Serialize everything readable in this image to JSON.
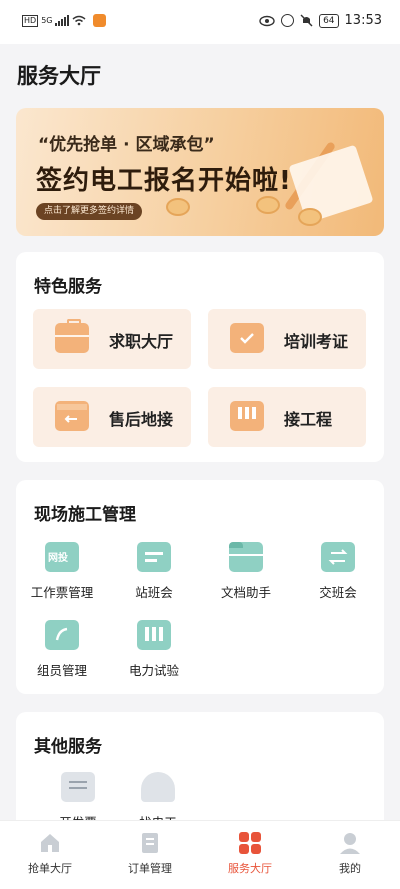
{
  "status_bar": {
    "left_badges": [
      "HD",
      "5G"
    ],
    "battery": "64",
    "time": "13:53",
    "icons": [
      "signal-icon",
      "wifi-icon",
      "app-notification-icon",
      "eye-icon",
      "alarm-icon",
      "mute-icon",
      "battery-icon"
    ]
  },
  "page": {
    "title": "服务大厅"
  },
  "banner": {
    "subtitle": "“优先抢单 · 区域承包”",
    "headline": "签约电工报名开始啦!",
    "pill": "点击了解更多签约详情"
  },
  "featured": {
    "title": "特色服务",
    "items": [
      {
        "label": "求职大厅",
        "icon": "briefcase-icon"
      },
      {
        "label": "培训考证",
        "icon": "certificate-icon"
      },
      {
        "label": "售后地接",
        "icon": "return-box-icon"
      },
      {
        "label": "接工程",
        "icon": "project-icon"
      }
    ]
  },
  "site_management": {
    "title": "现场施工管理",
    "items": [
      {
        "label": "工作票管理",
        "icon": "work-ticket-icon",
        "badge": "网投"
      },
      {
        "label": "站班会",
        "icon": "meeting-board-icon"
      },
      {
        "label": "文档助手",
        "icon": "folder-icon"
      },
      {
        "label": "交班会",
        "icon": "handover-icon"
      },
      {
        "label": "组员管理",
        "icon": "contacts-icon"
      },
      {
        "label": "电力试验",
        "icon": "power-test-icon"
      }
    ]
  },
  "other_services": {
    "title": "其他服务",
    "items": [
      {
        "label": "开发票",
        "icon": "invoice-icon"
      },
      {
        "label": "找电工",
        "icon": "helmet-icon"
      }
    ]
  },
  "tabbar": {
    "items": [
      {
        "label": "抢单大厅",
        "icon": "home-icon",
        "active": false
      },
      {
        "label": "订单管理",
        "icon": "order-icon",
        "active": false
      },
      {
        "label": "服务大厅",
        "icon": "grid-icon",
        "active": true
      },
      {
        "label": "我的",
        "icon": "profile-icon",
        "active": false
      }
    ]
  },
  "colors": {
    "accent": "#e8543a",
    "feature_tile": "#fbeee4",
    "feature_icon": "#f3b27a",
    "tool_icon_teal": "#6bc0b0"
  }
}
